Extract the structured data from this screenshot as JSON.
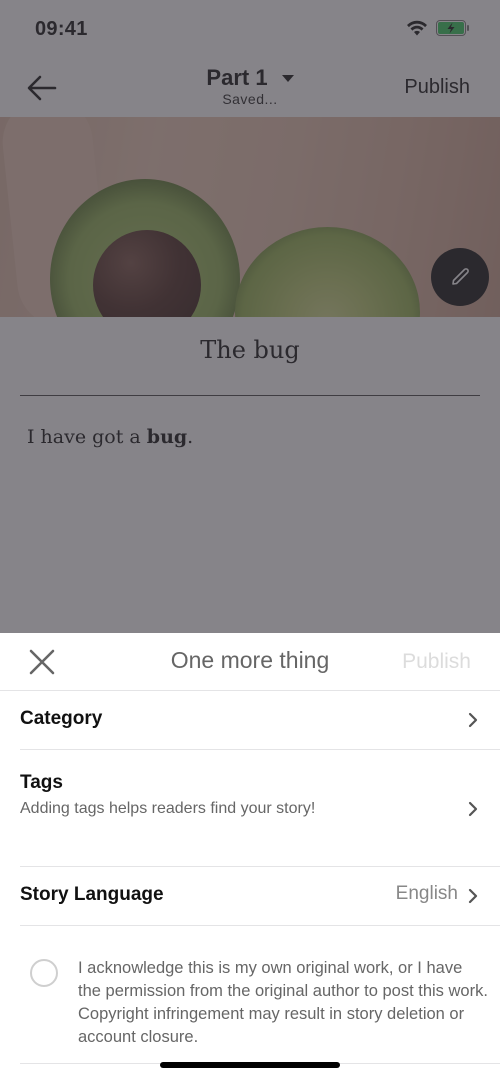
{
  "status_bar": {
    "time": "09:41",
    "wifi_icon": "wifi-icon",
    "battery_icon": "battery-charging-icon",
    "battery_color": "#34c759"
  },
  "editor": {
    "back_icon": "arrow-left-icon",
    "part_title": "Part 1",
    "part_dropdown_icon": "caret-down-icon",
    "save_status": "Saved...",
    "publish_label": "Publish",
    "edit_cover_icon": "pencil-icon",
    "story_title": "The bug",
    "body_text_plain": "I have got a ",
    "body_text_bold": "bug",
    "body_text_end": "."
  },
  "sheet": {
    "close_icon": "close-icon",
    "title": "One more thing",
    "publish_label": "Publish",
    "publish_enabled": false,
    "rows": [
      {
        "label": "Category",
        "chevron": "chevron-right-icon"
      },
      {
        "label": "Tags",
        "sublabel": "Adding tags helps readers find your story!",
        "chevron": "chevron-right-icon"
      },
      {
        "label": "Story Language",
        "value": "English",
        "chevron": "chevron-right-icon"
      }
    ],
    "acknowledgement": {
      "checked": false,
      "text": "I acknowledge this is my own original work, or I have the permission from the original author to post this work. Copyright infringement may result in story deletion or account closure."
    }
  },
  "colors": {
    "overlay": "#807e81",
    "muted_text": "#666666",
    "disabled_text": "#dcdcdc",
    "divider": "#e4e4e6"
  }
}
